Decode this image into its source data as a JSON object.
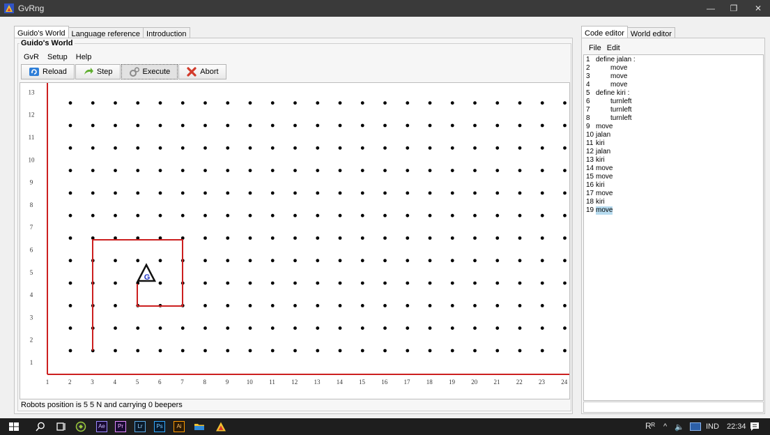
{
  "window": {
    "title": "GvRng",
    "controls": [
      "minimize-icon",
      "restore-icon",
      "close-icon"
    ],
    "close_label": "✕",
    "minimize_label": "—",
    "restore_label": "❐"
  },
  "left_tabs": [
    {
      "label": "Guido's World",
      "active": true
    },
    {
      "label": "Language reference",
      "active": false
    },
    {
      "label": "Introduction",
      "active": false
    }
  ],
  "right_tabs": [
    {
      "label": "Code editor",
      "active": true
    },
    {
      "label": "World editor",
      "active": false
    }
  ],
  "world_panel": {
    "group_title": "Guido's World",
    "menu": [
      "GvR",
      "Setup",
      "Help"
    ],
    "toolbar": {
      "reload": "Reload",
      "step": "Step",
      "execute": "Execute",
      "abort": "Abort"
    }
  },
  "world": {
    "x_labels": [
      "1",
      "2",
      "3",
      "4",
      "5",
      "6",
      "7",
      "8",
      "9",
      "10",
      "11",
      "12",
      "13",
      "14",
      "15",
      "16",
      "17",
      "18",
      "19",
      "20",
      "21",
      "22",
      "23",
      "24"
    ],
    "y_labels": [
      "1",
      "2",
      "3",
      "4",
      "5",
      "6",
      "7",
      "8",
      "9",
      "10",
      "11",
      "12",
      "13"
    ],
    "robot": {
      "street": 5,
      "avenue": 5,
      "direction": "N",
      "label": "G"
    },
    "walls_color": "#cc1f1f",
    "robot_color": "#1a2fc4"
  },
  "status": "Robots position is 5 5 N and carrying 0 beepers",
  "editor": {
    "menu": [
      "File",
      "Edit"
    ],
    "lines": [
      {
        "n": "1",
        "code": "define jalan :",
        "indent": 0
      },
      {
        "n": "2",
        "code": "move",
        "indent": 1
      },
      {
        "n": "3",
        "code": "move",
        "indent": 1
      },
      {
        "n": "4",
        "code": "move",
        "indent": 1
      },
      {
        "n": "5",
        "code": "define kiri :",
        "indent": 0
      },
      {
        "n": "6",
        "code": "turnleft",
        "indent": 1
      },
      {
        "n": "7",
        "code": "turnleft",
        "indent": 1
      },
      {
        "n": "8",
        "code": "turnleft",
        "indent": 1
      },
      {
        "n": "9",
        "code": "move",
        "indent": 0
      },
      {
        "n": "10",
        "code": "jalan",
        "indent": 0
      },
      {
        "n": "11",
        "code": "kiri",
        "indent": 0
      },
      {
        "n": "12",
        "code": "jalan",
        "indent": 0
      },
      {
        "n": "13",
        "code": "kiri",
        "indent": 0
      },
      {
        "n": "14",
        "code": "move",
        "indent": 0
      },
      {
        "n": "15",
        "code": "move",
        "indent": 0
      },
      {
        "n": "16",
        "code": "kiri",
        "indent": 0
      },
      {
        "n": "17",
        "code": "move",
        "indent": 0
      },
      {
        "n": "18",
        "code": "kiri",
        "indent": 0
      },
      {
        "n": "19",
        "code": "move",
        "indent": 0,
        "highlight": true
      }
    ]
  },
  "taskbar": {
    "apps": [
      "windows-start-icon",
      "search-icon",
      "task-view-icon",
      "app-icon",
      "after-effects-icon",
      "premiere-icon",
      "lightroom-icon",
      "photoshop-icon",
      "illustrator-icon",
      "file-explorer-icon",
      "gvrng-icon"
    ],
    "app_labels": {
      "ae": "Ae",
      "pr": "Pr",
      "lr": "Lr",
      "ps": "Ps",
      "ai": "Ai"
    },
    "tray": {
      "people": "Rᴿ",
      "lang": "IND",
      "time": "22:34"
    }
  }
}
